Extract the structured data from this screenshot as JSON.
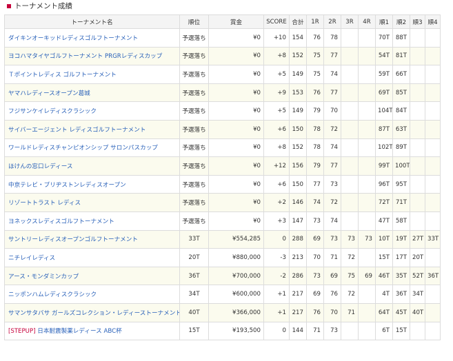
{
  "section": {
    "title": "トーナメント成績"
  },
  "table": {
    "headers": [
      "トーナメント名",
      "順位",
      "賞金",
      "SCORE",
      "合計",
      "1R",
      "2R",
      "3R",
      "4R",
      "順1",
      "順2",
      "順3",
      "順4"
    ],
    "rows": [
      {
        "prefix": "",
        "name": "ダイキンオーキッドレディスゴルフトーナメント",
        "rank": "予選落ち",
        "prize": "¥0",
        "score": "+10",
        "total": "154",
        "r1": "76",
        "r2": "78",
        "r3": "",
        "r4": "",
        "p1": "70T",
        "p2": "88T",
        "p3": "",
        "p4": ""
      },
      {
        "prefix": "",
        "name": "ヨコハマタイヤゴルフトーナメント PRGRレディスカップ",
        "rank": "予選落ち",
        "prize": "¥0",
        "score": "+8",
        "total": "152",
        "r1": "75",
        "r2": "77",
        "r3": "",
        "r4": "",
        "p1": "54T",
        "p2": "81T",
        "p3": "",
        "p4": ""
      },
      {
        "prefix": "",
        "name": "Ｔポイントレディス ゴルフトーナメント",
        "rank": "予選落ち",
        "prize": "¥0",
        "score": "+5",
        "total": "149",
        "r1": "75",
        "r2": "74",
        "r3": "",
        "r4": "",
        "p1": "59T",
        "p2": "66T",
        "p3": "",
        "p4": ""
      },
      {
        "prefix": "",
        "name": "ヤマハレディースオープン葛城",
        "rank": "予選落ち",
        "prize": "¥0",
        "score": "+9",
        "total": "153",
        "r1": "76",
        "r2": "77",
        "r3": "",
        "r4": "",
        "p1": "69T",
        "p2": "85T",
        "p3": "",
        "p4": ""
      },
      {
        "prefix": "",
        "name": "フジサンケイレディスクラシック",
        "rank": "予選落ち",
        "prize": "¥0",
        "score": "+5",
        "total": "149",
        "r1": "79",
        "r2": "70",
        "r3": "",
        "r4": "",
        "p1": "104T",
        "p2": "84T",
        "p3": "",
        "p4": ""
      },
      {
        "prefix": "",
        "name": "サイバーエージェント レディスゴルフトーナメント",
        "rank": "予選落ち",
        "prize": "¥0",
        "score": "+6",
        "total": "150",
        "r1": "78",
        "r2": "72",
        "r3": "",
        "r4": "",
        "p1": "87T",
        "p2": "63T",
        "p3": "",
        "p4": ""
      },
      {
        "prefix": "",
        "name": "ワールドレディスチャンピオンシップ サロンパスカップ",
        "rank": "予選落ち",
        "prize": "¥0",
        "score": "+8",
        "total": "152",
        "r1": "78",
        "r2": "74",
        "r3": "",
        "r4": "",
        "p1": "102T",
        "p2": "89T",
        "p3": "",
        "p4": ""
      },
      {
        "prefix": "",
        "name": "ほけんの窓口レディース",
        "rank": "予選落ち",
        "prize": "¥0",
        "score": "+12",
        "total": "156",
        "r1": "79",
        "r2": "77",
        "r3": "",
        "r4": "",
        "p1": "99T",
        "p2": "100T",
        "p3": "",
        "p4": ""
      },
      {
        "prefix": "",
        "name": "中京テレビ・ブリヂストンレディスオープン",
        "rank": "予選落ち",
        "prize": "¥0",
        "score": "+6",
        "total": "150",
        "r1": "77",
        "r2": "73",
        "r3": "",
        "r4": "",
        "p1": "96T",
        "p2": "95T",
        "p3": "",
        "p4": ""
      },
      {
        "prefix": "",
        "name": "リゾートトラスト レディス",
        "rank": "予選落ち",
        "prize": "¥0",
        "score": "+2",
        "total": "146",
        "r1": "74",
        "r2": "72",
        "r3": "",
        "r4": "",
        "p1": "72T",
        "p2": "71T",
        "p3": "",
        "p4": ""
      },
      {
        "prefix": "",
        "name": "ヨネックスレディスゴルフトーナメント",
        "rank": "予選落ち",
        "prize": "¥0",
        "score": "+3",
        "total": "147",
        "r1": "73",
        "r2": "74",
        "r3": "",
        "r4": "",
        "p1": "47T",
        "p2": "58T",
        "p3": "",
        "p4": ""
      },
      {
        "prefix": "",
        "name": "サントリーレディスオープンゴルフトーナメント",
        "rank": "33T",
        "prize": "¥554,285",
        "score": "0",
        "total": "288",
        "r1": "69",
        "r2": "73",
        "r3": "73",
        "r4": "73",
        "p1": "10T",
        "p2": "19T",
        "p3": "27T",
        "p4": "33T"
      },
      {
        "prefix": "",
        "name": "ニチレイレディス",
        "rank": "20T",
        "prize": "¥880,000",
        "score": "-3",
        "total": "213",
        "r1": "70",
        "r2": "71",
        "r3": "72",
        "r4": "",
        "p1": "15T",
        "p2": "17T",
        "p3": "20T",
        "p4": ""
      },
      {
        "prefix": "",
        "name": "アース・モンダミンカップ",
        "rank": "36T",
        "prize": "¥700,000",
        "score": "-2",
        "total": "286",
        "r1": "73",
        "r2": "69",
        "r3": "75",
        "r4": "69",
        "p1": "46T",
        "p2": "35T",
        "p3": "52T",
        "p4": "36T"
      },
      {
        "prefix": "",
        "name": "ニッポンハムレディスクラシック",
        "rank": "34T",
        "prize": "¥600,000",
        "score": "+1",
        "total": "217",
        "r1": "69",
        "r2": "76",
        "r3": "72",
        "r4": "",
        "p1": "4T",
        "p2": "36T",
        "p3": "34T",
        "p4": ""
      },
      {
        "prefix": "",
        "name": "サマンサタバサ ガールズコレクション・レディーストーナメント",
        "rank": "40T",
        "prize": "¥366,000",
        "score": "+1",
        "total": "217",
        "r1": "76",
        "r2": "70",
        "r3": "71",
        "r4": "",
        "p1": "64T",
        "p2": "45T",
        "p3": "40T",
        "p4": ""
      },
      {
        "prefix": "[STEPUP]",
        "name": " 日本耐震製薬レディース ABC杯",
        "rank": "15T",
        "prize": "¥193,500",
        "score": "0",
        "total": "144",
        "r1": "71",
        "r2": "73",
        "r3": "",
        "r4": "",
        "p1": "6T",
        "p2": "15T",
        "p3": "",
        "p4": ""
      }
    ]
  },
  "colors": {
    "accent": "#c6003b",
    "link": "#2860b9",
    "header_bg": "#f4f4f4",
    "stripe_bg": "#fbfbee",
    "border": "#dcdcdc"
  }
}
